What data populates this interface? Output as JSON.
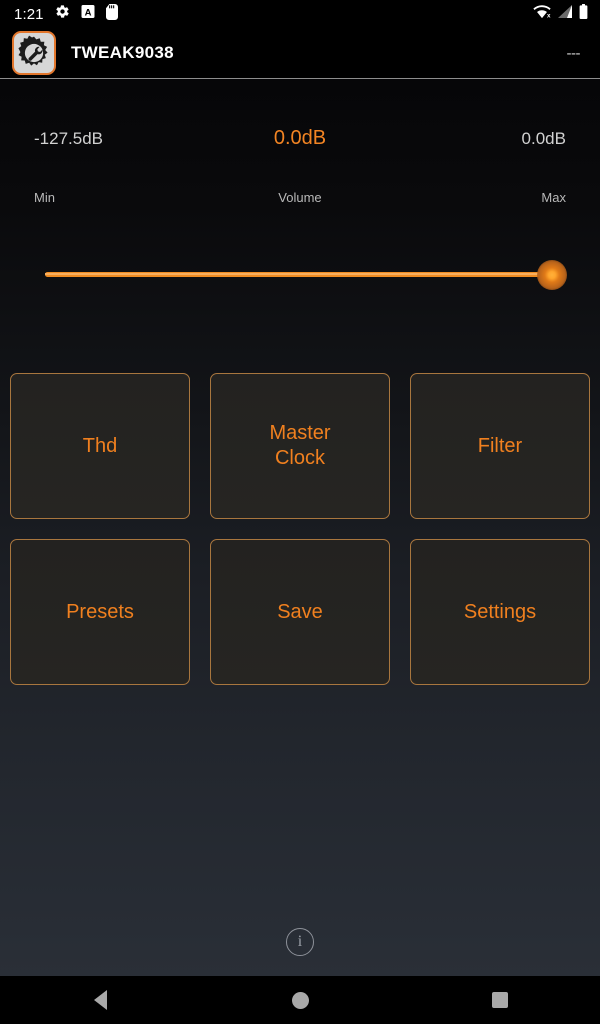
{
  "status_bar": {
    "clock": "1:21",
    "left_icons": [
      "gear-icon",
      "a-badge-icon",
      "sd-card-icon"
    ],
    "right_icons": [
      "wifi-off-icon",
      "cellular-signal-icon",
      "battery-icon"
    ]
  },
  "app_bar": {
    "icon": "gear-wrench-icon",
    "title": "TWEAK9038",
    "overflow_label": "---"
  },
  "volume": {
    "min_value": "-127.5dB",
    "current_value": "0.0dB",
    "max_value": "0.0dB",
    "min_label": "Min",
    "center_label": "Volume",
    "max_label": "Max",
    "slider_percent": 100,
    "accent_color": "#f28423",
    "track_color": "#ef8c21"
  },
  "tiles": [
    {
      "label": "Thd"
    },
    {
      "label": "Master\nClock"
    },
    {
      "label": "Filter"
    },
    {
      "label": "Presets"
    },
    {
      "label": "Save"
    },
    {
      "label": "Settings"
    }
  ],
  "info_button": {
    "glyph": "i"
  },
  "nav_bar": {
    "back": "back-icon",
    "home": "home-icon",
    "recents": "recents-icon"
  },
  "theme": {
    "accent": "#f0801f",
    "border": "#a8763e",
    "tile_fill": "#242320",
    "text_muted": "#b9b9b9"
  }
}
